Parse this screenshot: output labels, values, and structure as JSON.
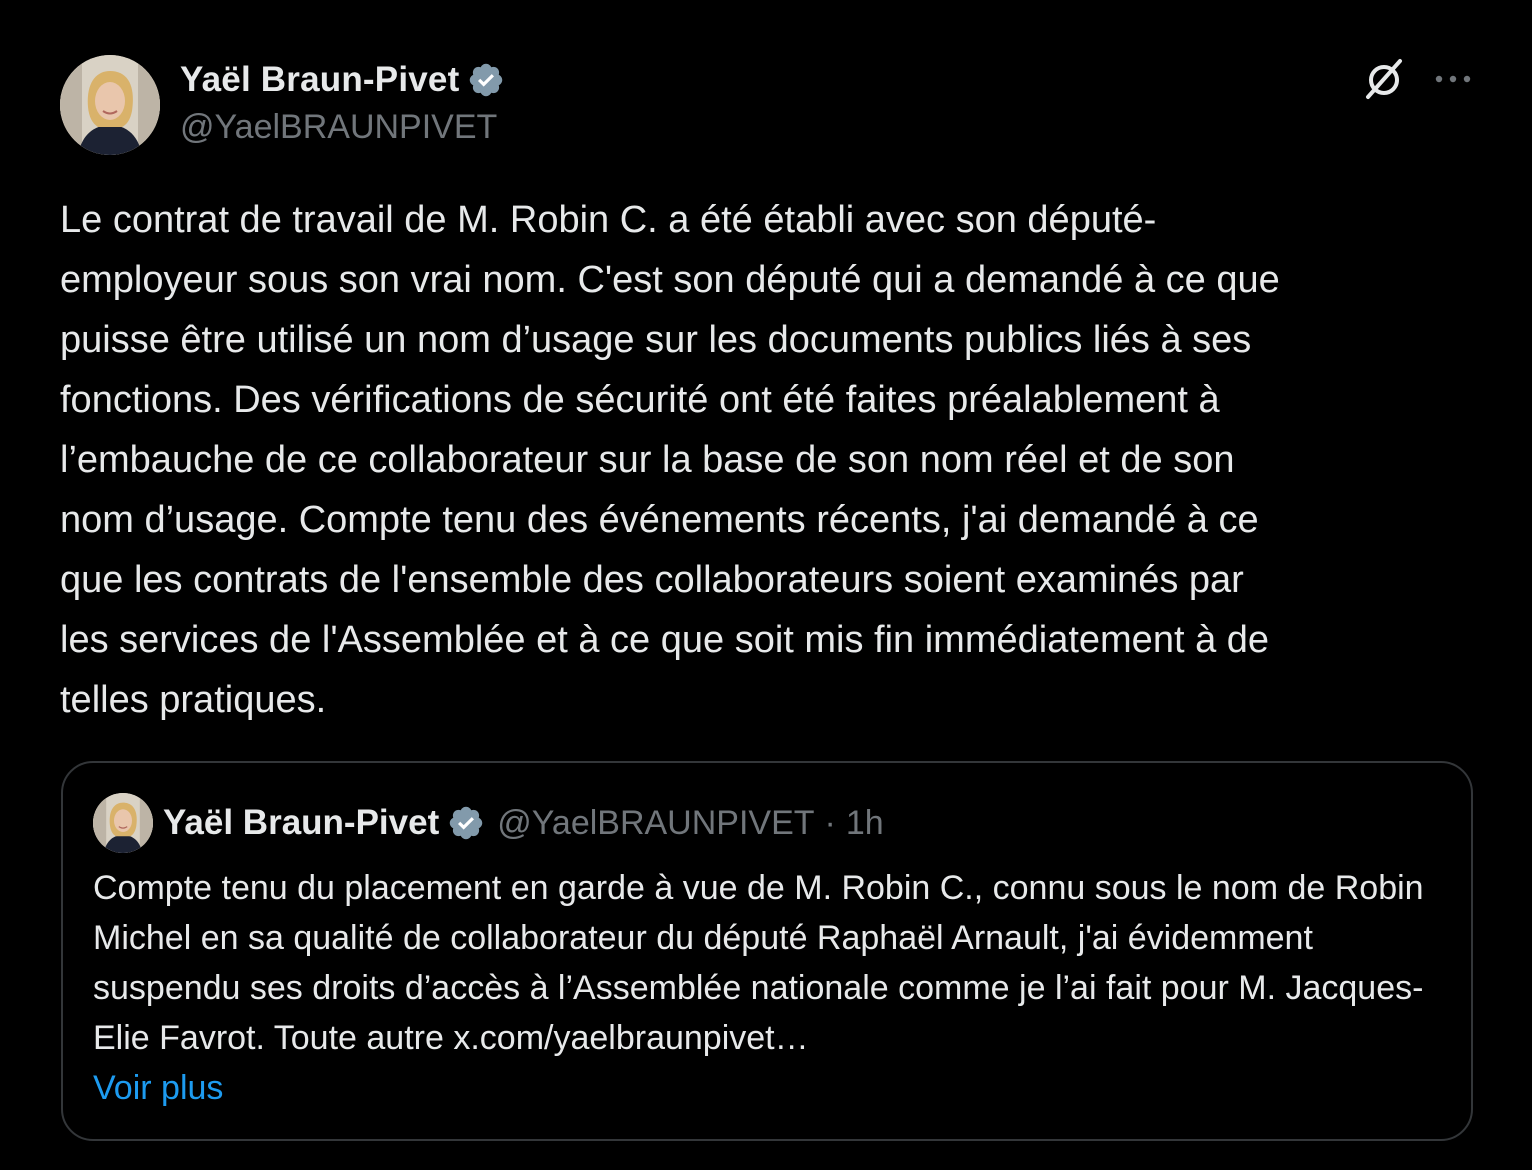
{
  "tweet": {
    "display_name": "Yaël Braun-Pivet",
    "handle": "@YaelBRAUNPIVET",
    "text": "Le contrat de travail de M. Robin C. a été établi avec son député-\nemployeur sous son vrai nom. C'est son député qui a demandé à ce que\npuisse être utilisé un nom d’usage sur les documents publics liés à ses\nfonctions. Des vérifications de sécurité ont été faites préalablement à\nl’embauche de ce collaborateur sur la base de son nom réel et de son\nnom d’usage. Compte tenu des événements récents, j'ai demandé à ce\nque les contrats de l'ensemble des collaborateurs soient examinés par\nles services de l'Assemblée et à ce que soit mis fin immédiatement à de\ntelles pratiques.",
    "icons": {
      "verified": "verified-badge-icon",
      "grok": "grok-icon",
      "more": "more-icon"
    }
  },
  "quote": {
    "display_name": "Yaël Braun-Pivet",
    "handle": "@YaelBRAUNPIVET",
    "separator": "·",
    "time": "1h",
    "text": "Compte tenu du placement en garde à vue de M. Robin C., connu sous le nom de Robin Michel en sa qualité de collaborateur du député Raphaël Arnault, j'ai évidemment suspendu ses droits d’accès à l’Assemblée nationale comme je l’ai fait pour M. Jacques-Elie Favrot. Toute autre x.com/yaelbraunpivet…",
    "show_more": "Voir plus"
  },
  "colors": {
    "background": "#000000",
    "text_primary": "#e7e9ea",
    "text_secondary": "#71767b",
    "link": "#1d9bf0",
    "border": "#333639",
    "verified": "#829aab"
  }
}
